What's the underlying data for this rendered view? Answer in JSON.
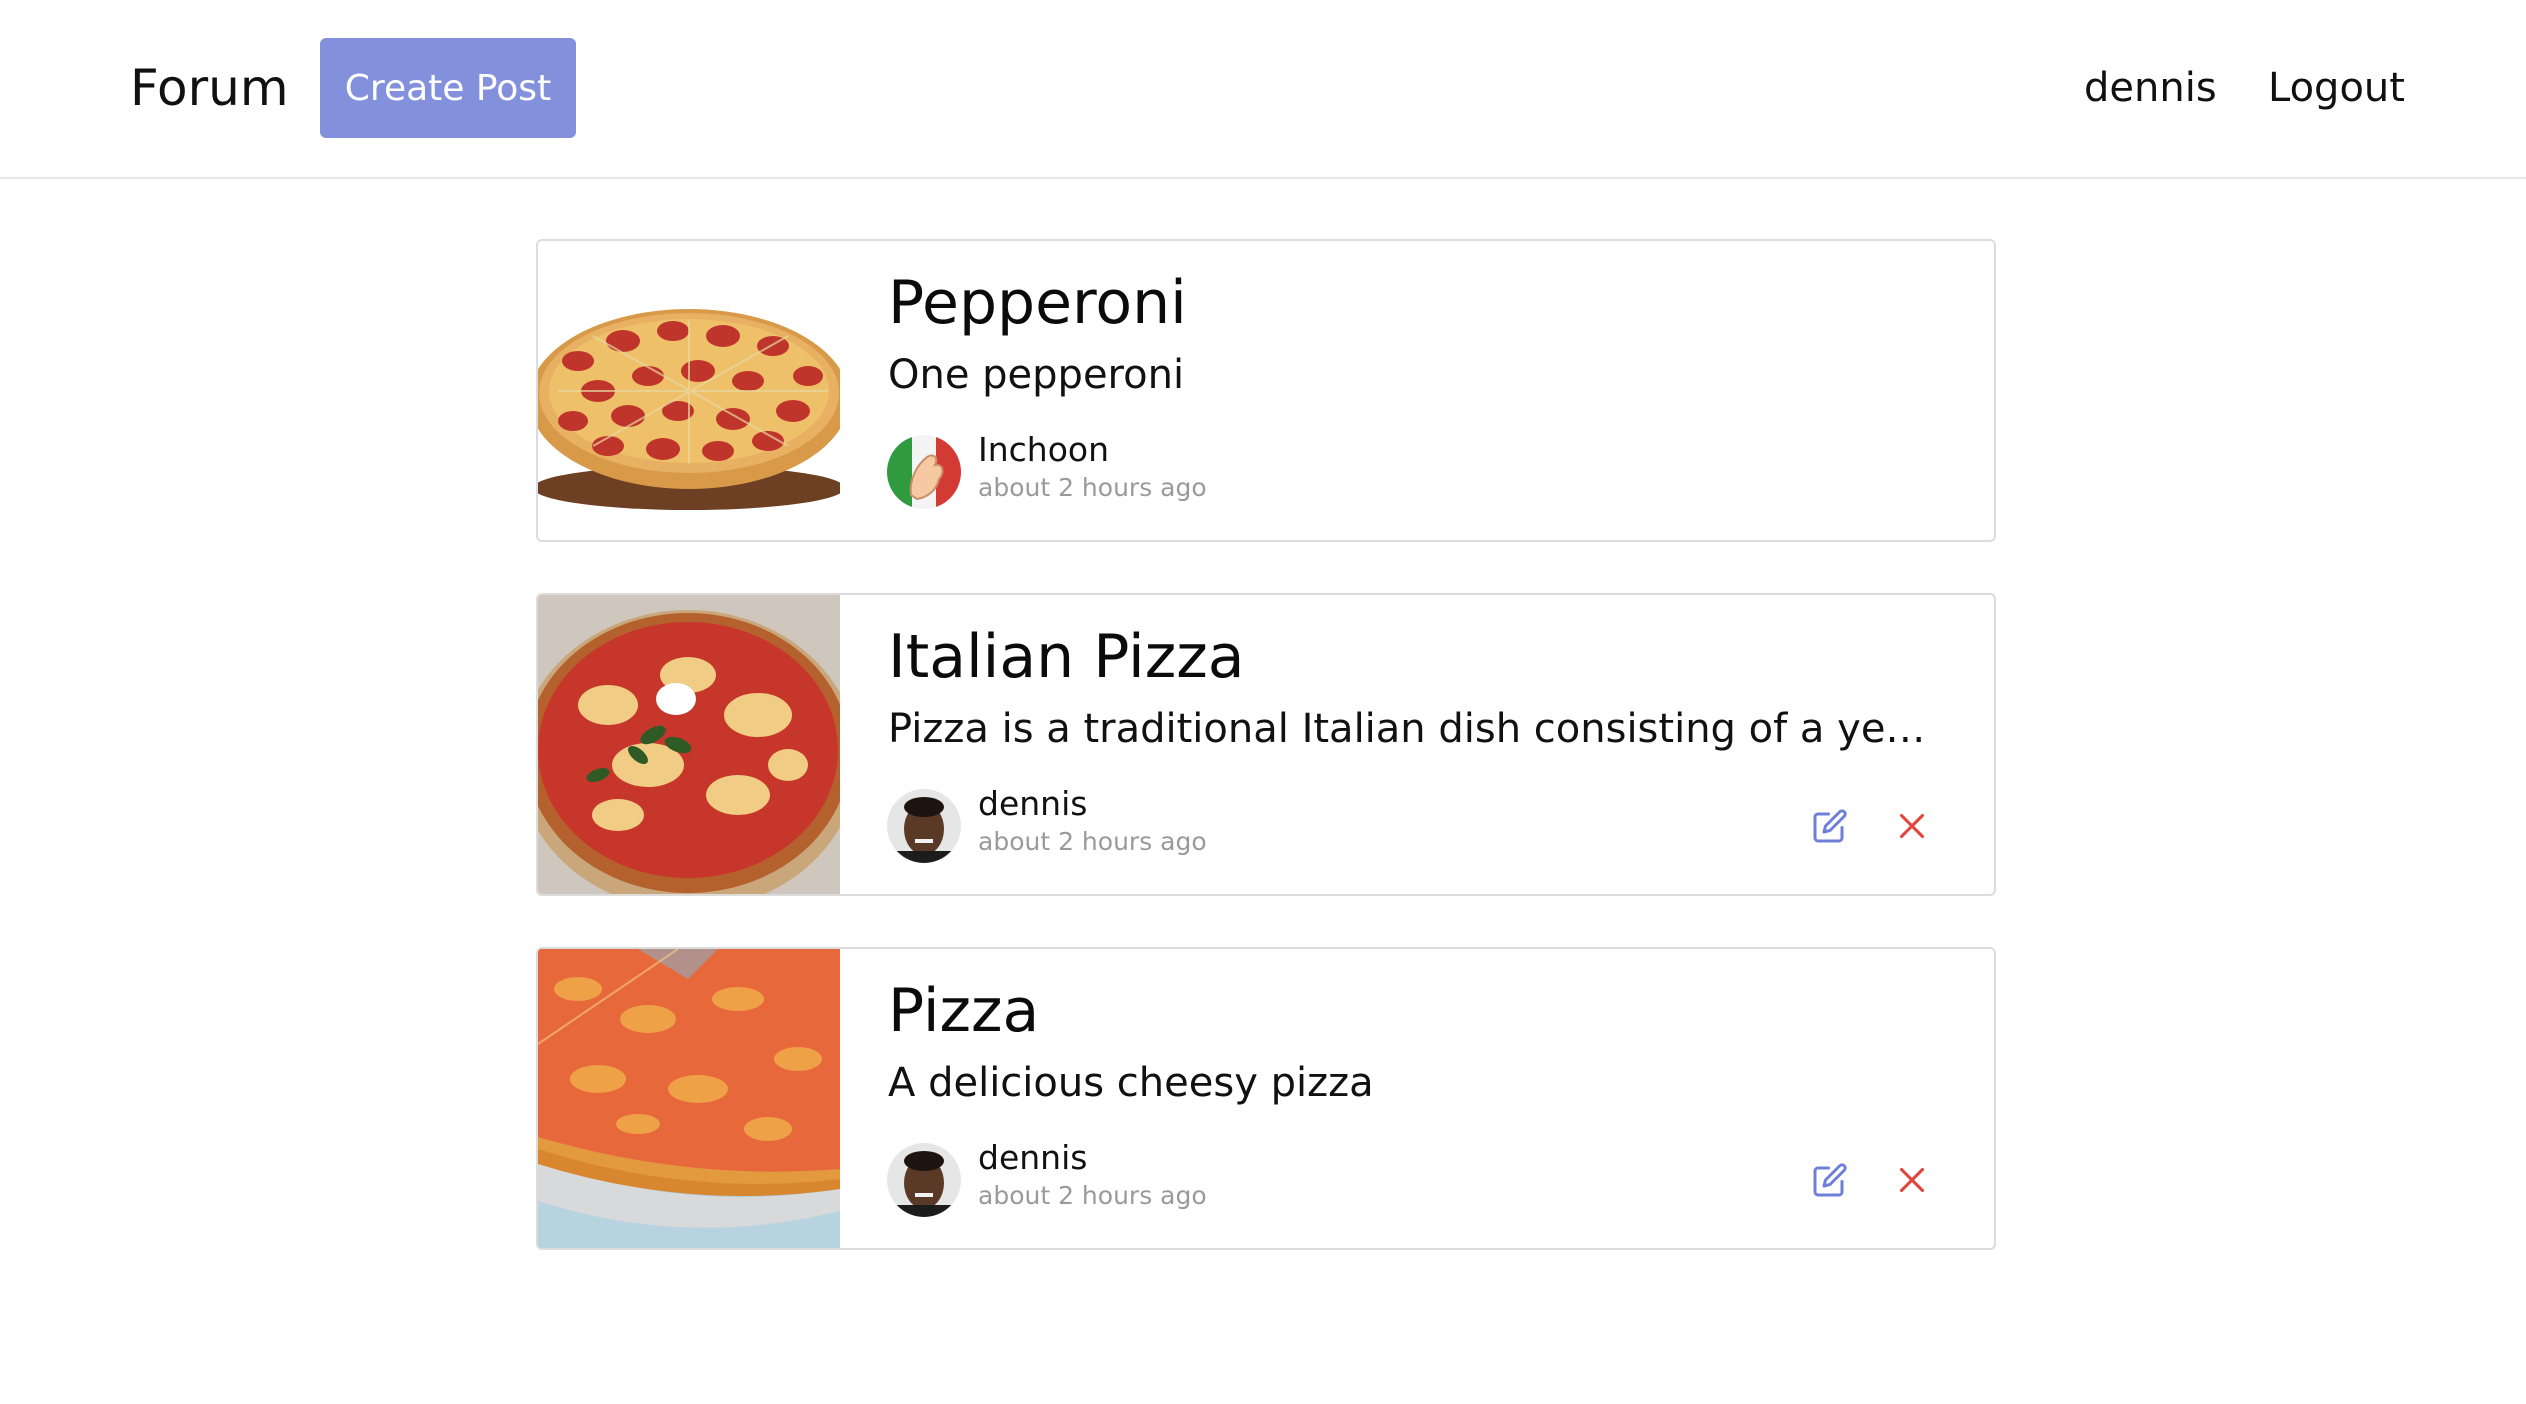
{
  "header": {
    "brand": "Forum",
    "create_post_label": "Create Post",
    "username": "dennis",
    "logout_label": "Logout"
  },
  "colors": {
    "accent": "#8391dd",
    "edit_icon": "#6f7fd8",
    "delete_icon": "#e2453c",
    "muted_text": "#9a9a9a",
    "card_border": "#dcdcdc"
  },
  "posts": [
    {
      "title": "Pepperoni",
      "body": "One pepperoni",
      "author": "Inchoon",
      "time": "about 2 hours ago",
      "thumbnail": "pepperoni-pizza-image",
      "avatar": "italian-hand-gesture-avatar"
    },
    {
      "title": "Italian Pizza",
      "body": "Pizza is a traditional Italian dish consisting of a yeasted …",
      "author": "dennis",
      "time": "about 2 hours ago",
      "thumbnail": "margherita-pizza-image",
      "avatar": "user-portrait-avatar",
      "actions": {
        "edit_icon": "edit-icon",
        "delete_icon": "close-icon"
      }
    },
    {
      "title": "Pizza",
      "body": "A delicious cheesy pizza",
      "author": "dennis",
      "time": "about 2 hours ago",
      "thumbnail": "cheese-pizza-image",
      "avatar": "user-portrait-avatar",
      "actions": {
        "edit_icon": "edit-icon",
        "delete_icon": "close-icon"
      }
    }
  ]
}
